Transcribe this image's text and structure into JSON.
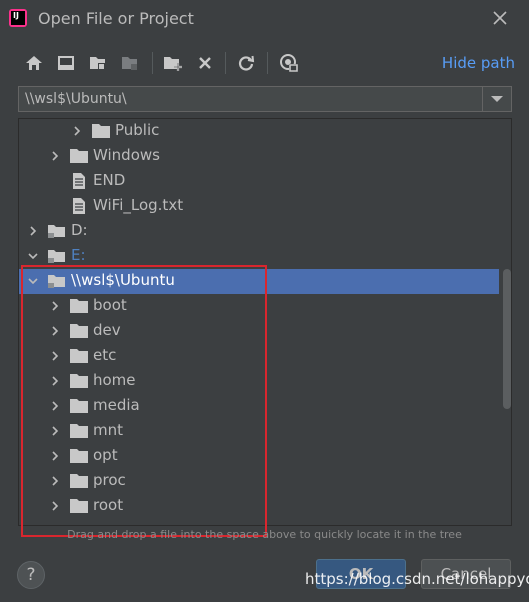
{
  "window": {
    "title": "Open File or Project",
    "app_icon_text": "IJ"
  },
  "toolbar": {
    "hide_path_label": "Hide path",
    "buttons": [
      "home-icon",
      "desktop-icon",
      "project-folder-icon",
      "module-folder-icon",
      "new-folder-icon",
      "delete-icon",
      "refresh-icon",
      "show-hidden-icon"
    ]
  },
  "path": {
    "value": "\\\\wsl$\\Ubuntu\\"
  },
  "tree": {
    "rows": [
      {
        "label": "Public",
        "type": "folder",
        "expanded": false,
        "selected": false
      },
      {
        "label": "Windows",
        "type": "folder",
        "expanded": false,
        "selected": false
      },
      {
        "label": "END",
        "type": "file",
        "expanded": false,
        "selected": false
      },
      {
        "label": "WiFi_Log.txt",
        "type": "file",
        "expanded": false,
        "selected": false
      },
      {
        "label": "D:",
        "type": "drive",
        "expanded": false,
        "selected": false
      },
      {
        "label": "E:",
        "type": "drive",
        "expanded": true,
        "selected": false
      },
      {
        "label": "\\\\wsl$\\Ubuntu",
        "type": "drive",
        "expanded": true,
        "selected": true
      },
      {
        "label": "boot",
        "type": "folder",
        "expanded": false,
        "selected": false
      },
      {
        "label": "dev",
        "type": "folder",
        "expanded": false,
        "selected": false
      },
      {
        "label": "etc",
        "type": "folder",
        "expanded": false,
        "selected": false
      },
      {
        "label": "home",
        "type": "folder",
        "expanded": false,
        "selected": false
      },
      {
        "label": "media",
        "type": "folder",
        "expanded": false,
        "selected": false
      },
      {
        "label": "mnt",
        "type": "folder",
        "expanded": false,
        "selected": false
      },
      {
        "label": "opt",
        "type": "folder",
        "expanded": false,
        "selected": false
      },
      {
        "label": "proc",
        "type": "folder",
        "expanded": false,
        "selected": false
      },
      {
        "label": "root",
        "type": "folder",
        "expanded": false,
        "selected": false
      }
    ]
  },
  "hint": "Drag and drop a file into the space above to quickly locate it in the tree",
  "footer": {
    "help_label": "?",
    "ok_label": "OK",
    "cancel_label": "Cancel"
  },
  "watermark": "https://blog.csdn.net/lohappyoi",
  "colors": {
    "background": "#3c3f41",
    "selection": "#4b6eaf",
    "link": "#589df6",
    "annotation_box": "#d9262e"
  }
}
